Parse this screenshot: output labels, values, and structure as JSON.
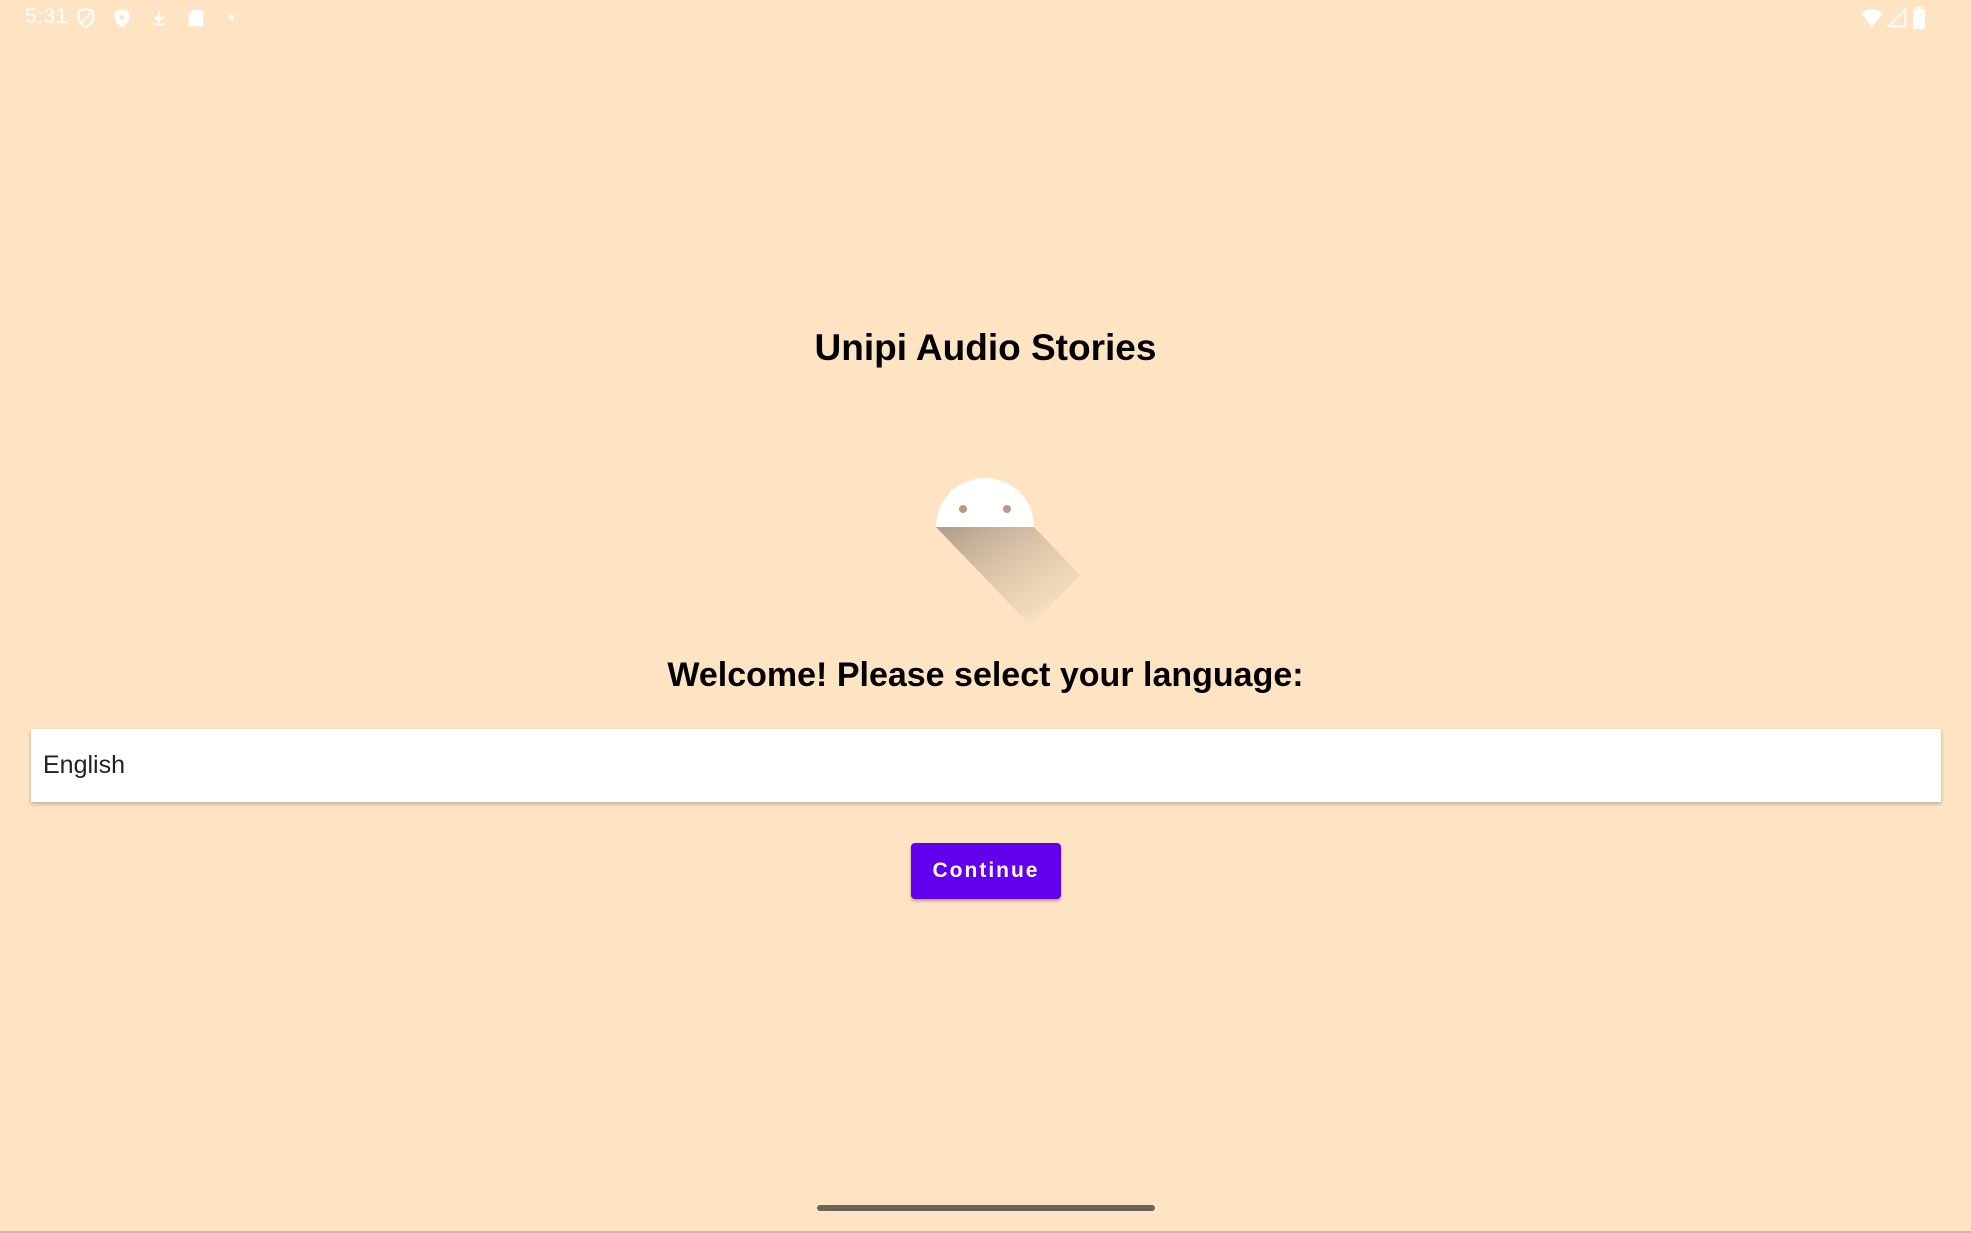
{
  "status_bar": {
    "time": "5:31",
    "left_icons": [
      "vpn-shield-icon",
      "security-shield-icon",
      "download-icon",
      "sd-card-icon",
      "notification-dot-icon"
    ],
    "right_icons": [
      "wifi-icon",
      "cell-signal-icon",
      "battery-icon"
    ]
  },
  "app": {
    "title": "Unipi Audio Stories",
    "logo": "android-logo-icon",
    "welcome_text": "Welcome! Please select your language:"
  },
  "language_select": {
    "selected": "English"
  },
  "actions": {
    "continue_label": "Continue"
  },
  "colors": {
    "background": "#FFE4C4",
    "accent": "#6200EE",
    "dropdown_bg": "#FFFFFF"
  }
}
